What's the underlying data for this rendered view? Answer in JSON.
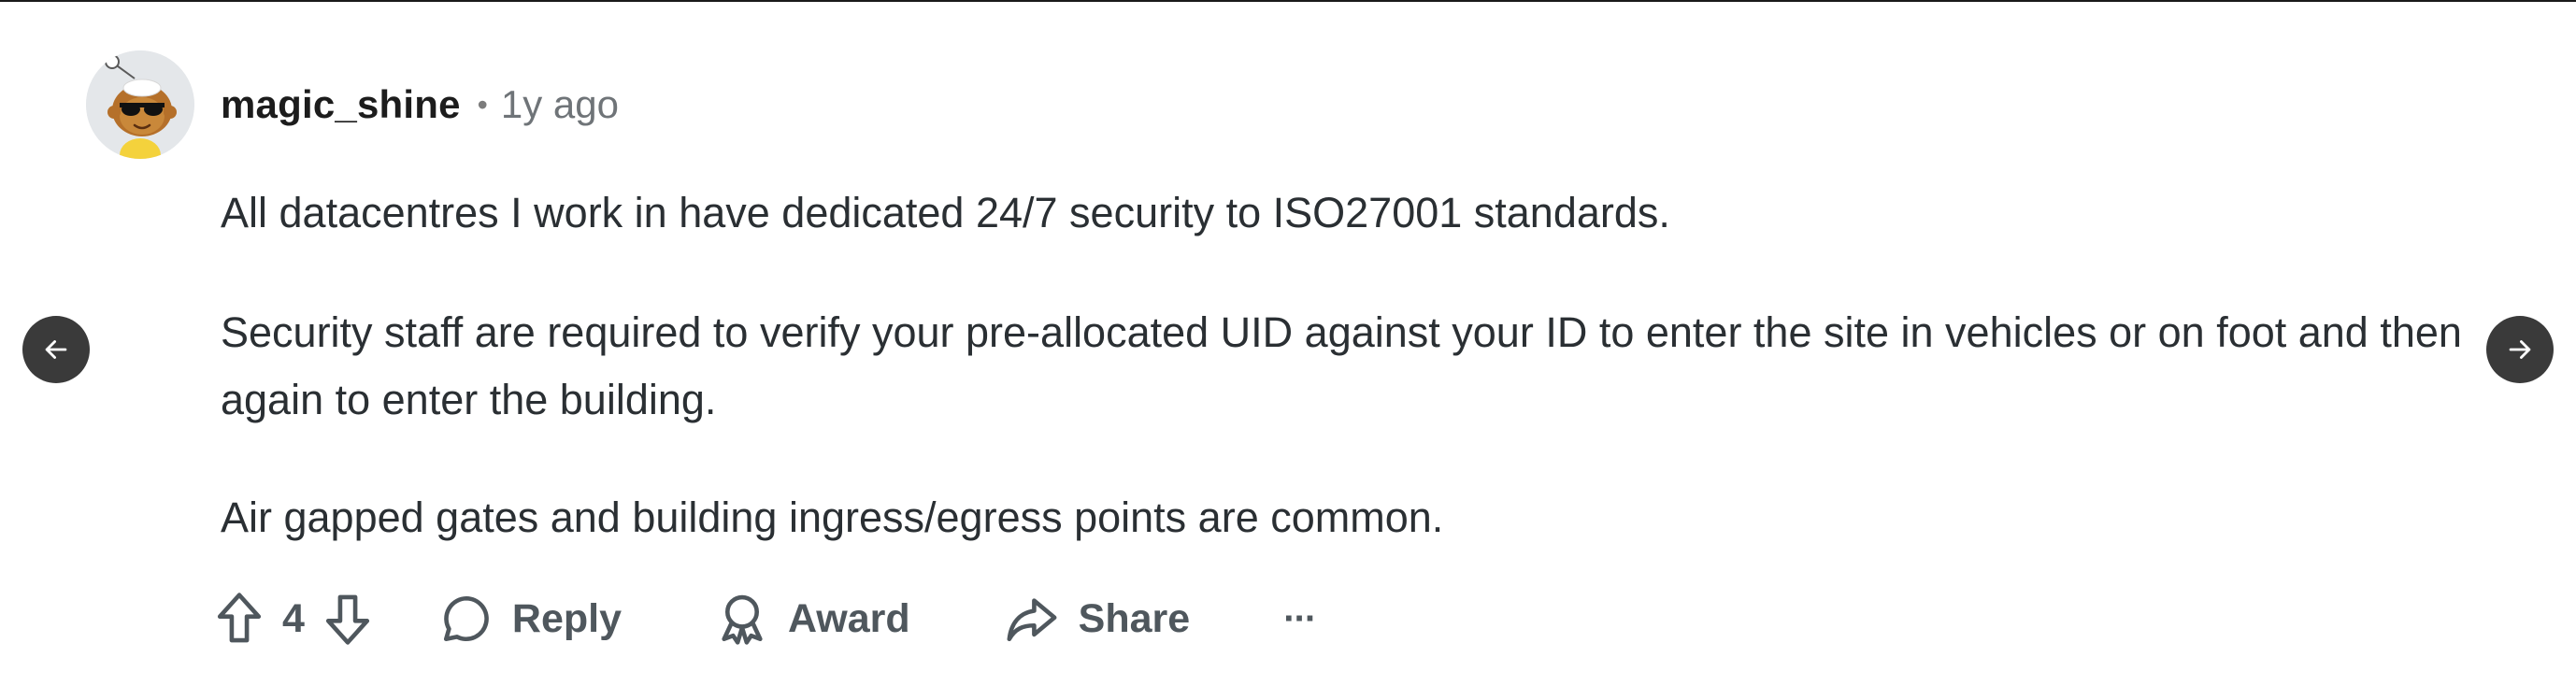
{
  "comment": {
    "username": "magic_shine",
    "separator": "•",
    "time": "1y ago",
    "paragraphs": [
      "All datacentres I work in have dedicated 24/7 security to ISO27001 standards.",
      "Security staff are required to verify your pre-allocated UID against your ID to enter the site in vehicles or on foot and then again to enter the building.",
      "Air gapped gates and building ingress/egress points are common."
    ]
  },
  "actions": {
    "vote_count": "4",
    "reply_label": "Reply",
    "award_label": "Award",
    "share_label": "Share",
    "more_label": "···"
  },
  "navigation": {
    "prev_icon": "arrow-left-icon",
    "next_icon": "arrow-right-icon"
  },
  "colors": {
    "nav_button": "#3a3a3a",
    "text": "#2a2f33",
    "muted": "#6f7478",
    "action": "#4f575d"
  }
}
